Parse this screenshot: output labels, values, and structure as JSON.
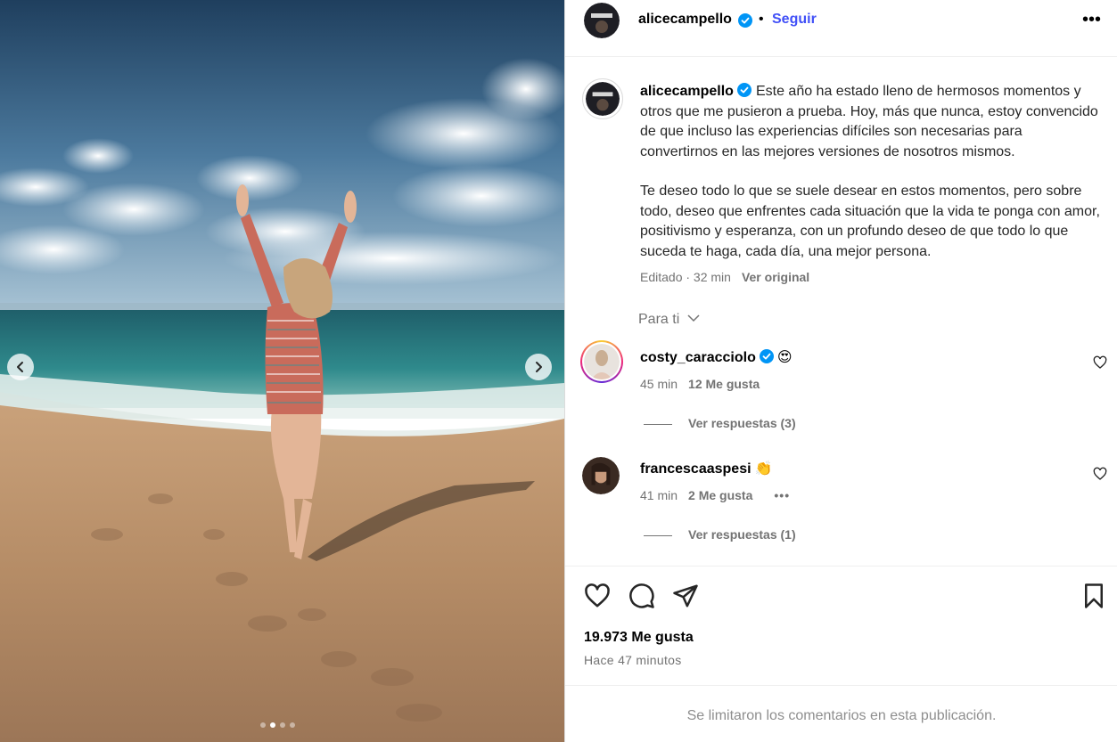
{
  "post": {
    "username": "alicecampello",
    "follow_label": "Seguir",
    "bullet": "•",
    "more_label": "•••"
  },
  "caption": {
    "username": "alicecampello",
    "paragraph1": "Este año ha estado lleno de hermosos momentos y otros que me pusieron a prueba. Hoy, más que nunca, estoy convencido de que incluso las experiencias difíciles son necesarias para convertirnos en las mejores versiones de nosotros mismos.",
    "paragraph2": "Te deseo todo lo que se suele desear en estos momentos, pero sobre todo, deseo que enfrentes cada situación que la vida te ponga con amor, positivismo y esperanza, con un profundo deseo de que todo lo que suceda te haga, cada día, una mejor persona.",
    "edited": "Editado · 32 min",
    "see_original": "Ver original"
  },
  "filter": {
    "label": "Para ti"
  },
  "comments": [
    {
      "username": "costy_caracciolo",
      "verified": true,
      "emoji": "😍",
      "time": "45 min",
      "likes": "12 Me gusta",
      "replies": "Ver respuestas (3)"
    },
    {
      "username": "francescaaspesi",
      "verified": false,
      "emoji": "👏",
      "time": "41 min",
      "likes": "2 Me gusta",
      "more": "•••",
      "replies": "Ver respuestas (1)"
    }
  ],
  "stats": {
    "likes": "19.973 Me gusta",
    "time_ago": "Hace 47 minutos"
  },
  "comments_limited": "Se limitaron los comentarios en esta publicación.",
  "carousel": {
    "total": 4,
    "active": 2
  },
  "colors": {
    "link_blue": "#4150f7",
    "verified_blue": "#0095f6",
    "muted": "#737373"
  },
  "icons": [
    "chevron-left-icon",
    "chevron-right-icon",
    "verified-badge-icon",
    "more-options-icon",
    "chevron-down-icon",
    "heart-icon",
    "comment-icon",
    "share-icon",
    "bookmark-icon"
  ]
}
